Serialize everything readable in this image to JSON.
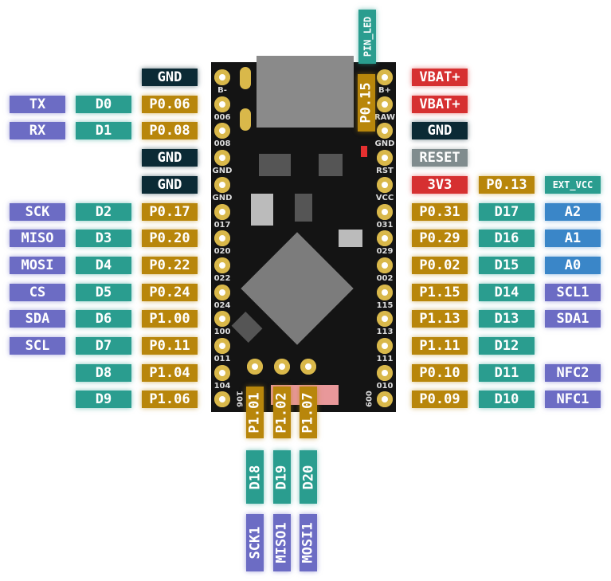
{
  "colors": {
    "gpio": "#b8860b",
    "digital": "#2a9d8f",
    "function": "#6c6cc4",
    "analog": "#3a86c8",
    "power": "#d63031",
    "ground": "#0b2a35",
    "reset": "#808c8e",
    "board": "#141414"
  },
  "left_rows": [
    {
      "silk": "B-",
      "gpio": {
        "text": "GND",
        "kind": "ground"
      }
    },
    {
      "silk": "006",
      "gpio": {
        "text": "P0.06",
        "kind": "gpio"
      },
      "digital": "D0",
      "function": "TX"
    },
    {
      "silk": "008",
      "gpio": {
        "text": "P0.08",
        "kind": "gpio"
      },
      "digital": "D1",
      "function": "RX"
    },
    {
      "silk": "GND",
      "gpio": {
        "text": "GND",
        "kind": "ground"
      }
    },
    {
      "silk": "GND",
      "gpio": {
        "text": "GND",
        "kind": "ground"
      }
    },
    {
      "silk": "017",
      "gpio": {
        "text": "P0.17",
        "kind": "gpio"
      },
      "digital": "D2",
      "function": "SCK"
    },
    {
      "silk": "020",
      "gpio": {
        "text": "P0.20",
        "kind": "gpio"
      },
      "digital": "D3",
      "function": "MISO"
    },
    {
      "silk": "022",
      "gpio": {
        "text": "P0.22",
        "kind": "gpio"
      },
      "digital": "D4",
      "function": "MOSI"
    },
    {
      "silk": "024",
      "gpio": {
        "text": "P0.24",
        "kind": "gpio"
      },
      "digital": "D5",
      "function": "CS"
    },
    {
      "silk": "100",
      "gpio": {
        "text": "P1.00",
        "kind": "gpio"
      },
      "digital": "D6",
      "function": "SDA"
    },
    {
      "silk": "011",
      "gpio": {
        "text": "P0.11",
        "kind": "gpio"
      },
      "digital": "D7",
      "function": "SCL"
    },
    {
      "silk": "104",
      "gpio": {
        "text": "P1.04",
        "kind": "gpio"
      },
      "digital": "D8"
    },
    {
      "silk": "106",
      "gpio": {
        "text": "P1.06",
        "kind": "gpio"
      },
      "digital": "D9"
    }
  ],
  "right_rows": [
    {
      "silk": "B+",
      "gpio": {
        "text": "VBAT+",
        "kind": "power"
      }
    },
    {
      "silk": "RAW",
      "gpio": {
        "text": "VBAT+",
        "kind": "power"
      }
    },
    {
      "silk": "GND",
      "gpio": {
        "text": "GND",
        "kind": "ground"
      }
    },
    {
      "silk": "RST",
      "gpio": {
        "text": "RESET",
        "kind": "reset"
      }
    },
    {
      "silk": "VCC",
      "gpio": {
        "text": "3V3",
        "kind": "power"
      },
      "digital": {
        "text": "P0.13",
        "kind": "gpio"
      },
      "function": {
        "text": "EXT_VCC",
        "kind": "digital"
      }
    },
    {
      "silk": "031",
      "gpio": {
        "text": "P0.31",
        "kind": "gpio"
      },
      "digital": {
        "text": "D17",
        "kind": "digital"
      },
      "function": {
        "text": "A2",
        "kind": "analog"
      }
    },
    {
      "silk": "029",
      "gpio": {
        "text": "P0.29",
        "kind": "gpio"
      },
      "digital": {
        "text": "D16",
        "kind": "digital"
      },
      "function": {
        "text": "A1",
        "kind": "analog"
      }
    },
    {
      "silk": "002",
      "gpio": {
        "text": "P0.02",
        "kind": "gpio"
      },
      "digital": {
        "text": "D15",
        "kind": "digital"
      },
      "function": {
        "text": "A0",
        "kind": "analog"
      }
    },
    {
      "silk": "115",
      "gpio": {
        "text": "P1.15",
        "kind": "gpio"
      },
      "digital": {
        "text": "D14",
        "kind": "digital"
      },
      "function": {
        "text": "SCL1",
        "kind": "function"
      }
    },
    {
      "silk": "113",
      "gpio": {
        "text": "P1.13",
        "kind": "gpio"
      },
      "digital": {
        "text": "D13",
        "kind": "digital"
      },
      "function": {
        "text": "SDA1",
        "kind": "function"
      }
    },
    {
      "silk": "111",
      "gpio": {
        "text": "P1.11",
        "kind": "gpio"
      },
      "digital": {
        "text": "D12",
        "kind": "digital"
      }
    },
    {
      "silk": "010",
      "gpio": {
        "text": "P0.10",
        "kind": "gpio"
      },
      "digital": {
        "text": "D11",
        "kind": "digital"
      },
      "function": {
        "text": "NFC2",
        "kind": "function"
      }
    },
    {
      "silk": "009",
      "gpio": {
        "text": "P0.09",
        "kind": "gpio"
      },
      "digital": {
        "text": "D10",
        "kind": "digital"
      },
      "function": {
        "text": "NFC1",
        "kind": "function"
      }
    }
  ],
  "bottom_pins": [
    {
      "gpio": "P1.01",
      "digital": "D18",
      "function": "SCK1"
    },
    {
      "gpio": "P1.02",
      "digital": "D19",
      "function": "MISO1"
    },
    {
      "gpio": "P1.07",
      "digital": "D20",
      "function": "MOSI1"
    }
  ],
  "led": {
    "label": "PIN_LED",
    "gpio": "P0.15"
  }
}
